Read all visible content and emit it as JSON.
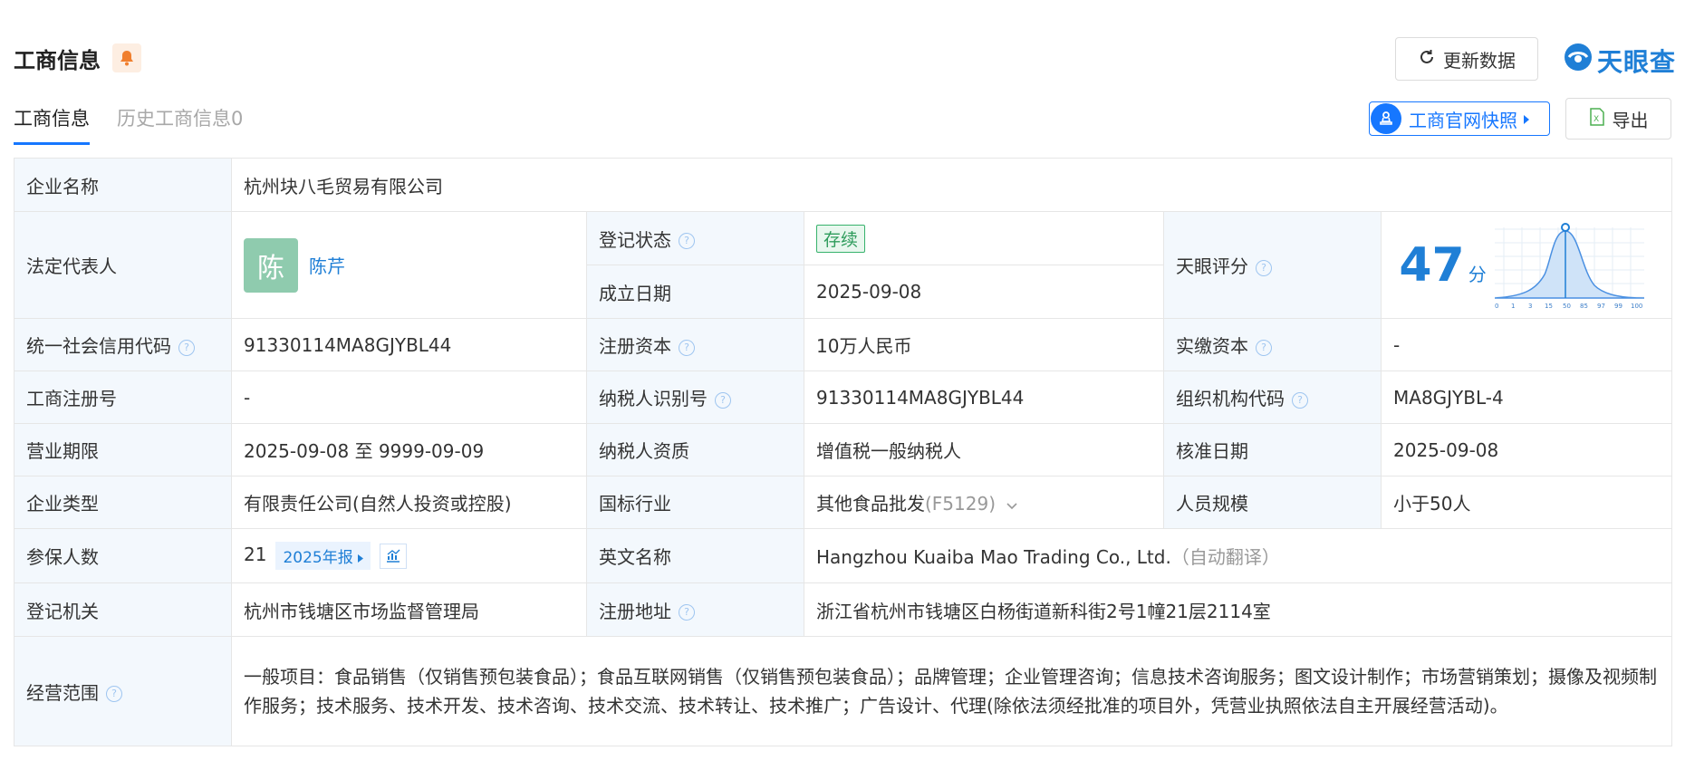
{
  "header": {
    "title": "工商信息",
    "refresh_label": "更新数据",
    "logo_text": "天眼查",
    "tabs": [
      {
        "label": "工商信息",
        "active": true
      },
      {
        "label": "历史工商信息0",
        "active": false
      }
    ],
    "snapshot_label": "工商官网快照",
    "export_label": "导出"
  },
  "colors": {
    "accent": "#1677ff",
    "status_green": "#37b26c",
    "label_bg": "#f3f8fd"
  },
  "company": {
    "name_label": "企业名称",
    "name": "杭州块八毛贸易有限公司",
    "legal_rep_label": "法定代表人",
    "legal_rep_avatar": "陈",
    "legal_rep": "陈芹",
    "reg_status_label": "登记状态",
    "reg_status": "存续",
    "found_date_label": "成立日期",
    "found_date": "2025-09-08",
    "score_label": "天眼评分",
    "score": "47",
    "score_unit": "分",
    "score_axis": [
      "0",
      "1",
      "3",
      "15",
      "50",
      "85",
      "97",
      "99",
      "100"
    ],
    "credit_code_label": "统一社会信用代码",
    "credit_code": "91330114MA8GJYBL44",
    "reg_capital_label": "注册资本",
    "reg_capital": "10万人民币",
    "paid_capital_label": "实缴资本",
    "paid_capital": "-",
    "reg_no_label": "工商注册号",
    "reg_no": "-",
    "taxpayer_id_label": "纳税人识别号",
    "taxpayer_id": "91330114MA8GJYBL44",
    "org_code_label": "组织机构代码",
    "org_code": "MA8GJYBL-4",
    "biz_term_label": "营业期限",
    "biz_term": "2025-09-08 至 9999-09-09",
    "taxpayer_qual_label": "纳税人资质",
    "taxpayer_qual": "增值税一般纳税人",
    "approve_date_label": "核准日期",
    "approve_date": "2025-09-08",
    "type_label": "企业类型",
    "type": "有限责任公司(自然人投资或控股)",
    "industry_label": "国标行业",
    "industry": "其他食品批发",
    "industry_code": "(F5129)",
    "staff_size_label": "人员规模",
    "staff_size": "小于50人",
    "insured_label": "参保人数",
    "insured": "21",
    "insured_report": "2025年报",
    "en_name_label": "英文名称",
    "en_name": "Hangzhou Kuaiba Mao Trading Co., Ltd.",
    "en_name_note": "（自动翻译）",
    "authority_label": "登记机关",
    "authority": "杭州市钱塘区市场监督管理局",
    "address_label": "注册地址",
    "address": "浙江省杭州市钱塘区白杨街道新科街2号1幢21层2114室",
    "scope_label": "经营范围",
    "scope": "一般项目：食品销售（仅销售预包装食品）；食品互联网销售（仅销售预包装食品）；品牌管理；企业管理咨询；信息技术咨询服务；图文设计制作；市场营销策划；摄像及视频制作服务；技术服务、技术开发、技术咨询、技术交流、技术转让、技术推广；广告设计、代理(除依法须经批准的项目外，凭营业执照依法自主开展经营活动)。"
  }
}
